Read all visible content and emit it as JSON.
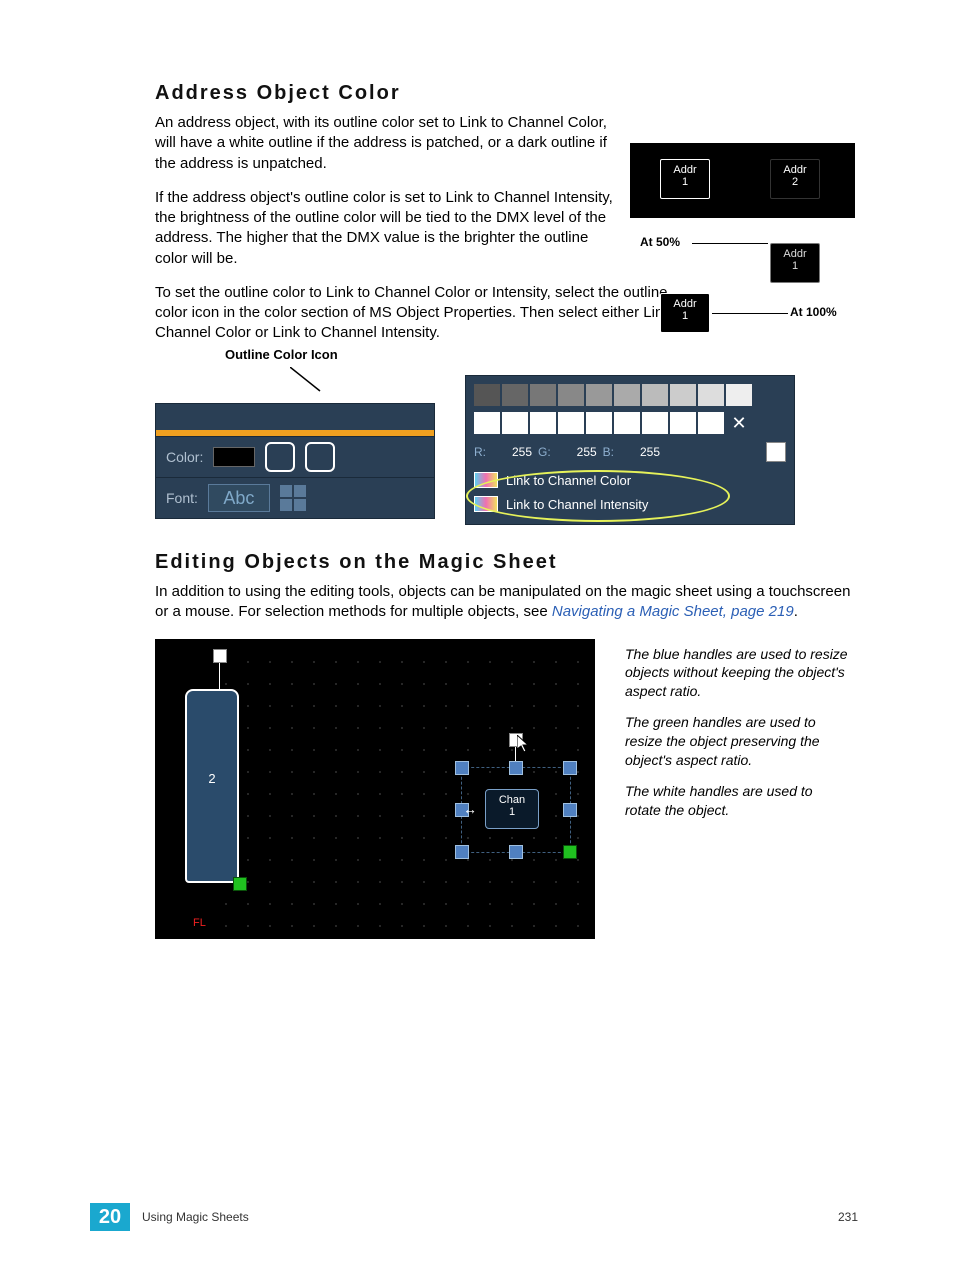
{
  "sections": {
    "addr": {
      "heading": "Address Object Color",
      "p1": "An address object, with its outline color set to Link to Channel Color, will have a white outline if the address is patched, or a dark outline if the address is unpatched.",
      "p2": "If the address object's outline color is set to Link to Channel Intensity, the brightness of the outline color will be tied to the DMX level of the address. The higher that the DMX value is the brighter the outline color will be.",
      "p3": "To set the outline color to Link to Channel Color or Intensity, select the outline color icon in the color section of MS Object Properties. Then select either Link to Channel Color or Link to Channel Intensity."
    },
    "edit": {
      "heading": "Editing Objects on the Magic Sheet",
      "p1a": "In addition to using the editing tools, objects can be manipulated on the magic sheet using a touchscreen or a mouse. For selection methods for multiple objects, see ",
      "link": "Navigating a Magic Sheet, page 219",
      "p1b": ".",
      "caption_blue": "The blue handles are used to resize objects without keeping the object's aspect ratio.",
      "caption_green": "The green handles are used to resize the object preserving the object's aspect ratio.",
      "caption_white": "The white handles are used to rotate the object."
    }
  },
  "addr_figure": {
    "addr1": "Addr",
    "n1": "1",
    "addr2": "Addr",
    "n2": "2",
    "lbl50": "At 50%",
    "lbl100": "At 100%"
  },
  "color_panel": {
    "outline_label": "Outline Color Icon",
    "row1_label": "Color:",
    "row2_label": "Font:",
    "abc": "Abc"
  },
  "picker_panel": {
    "r_label": "R:",
    "g_label": "G:",
    "b_label": "B:",
    "r_val": "255",
    "g_val": "255",
    "b_val": "255",
    "link_color": "Link to Channel Color",
    "link_intensity": "Link to Channel Intensity"
  },
  "ms_figure": {
    "fixture_num": "2",
    "fl": "FL",
    "chan_label": "Chan",
    "chan_num": "1"
  },
  "footer": {
    "chapter_num": "20",
    "chapter_title": "Using Magic Sheets",
    "page_num": "231"
  }
}
